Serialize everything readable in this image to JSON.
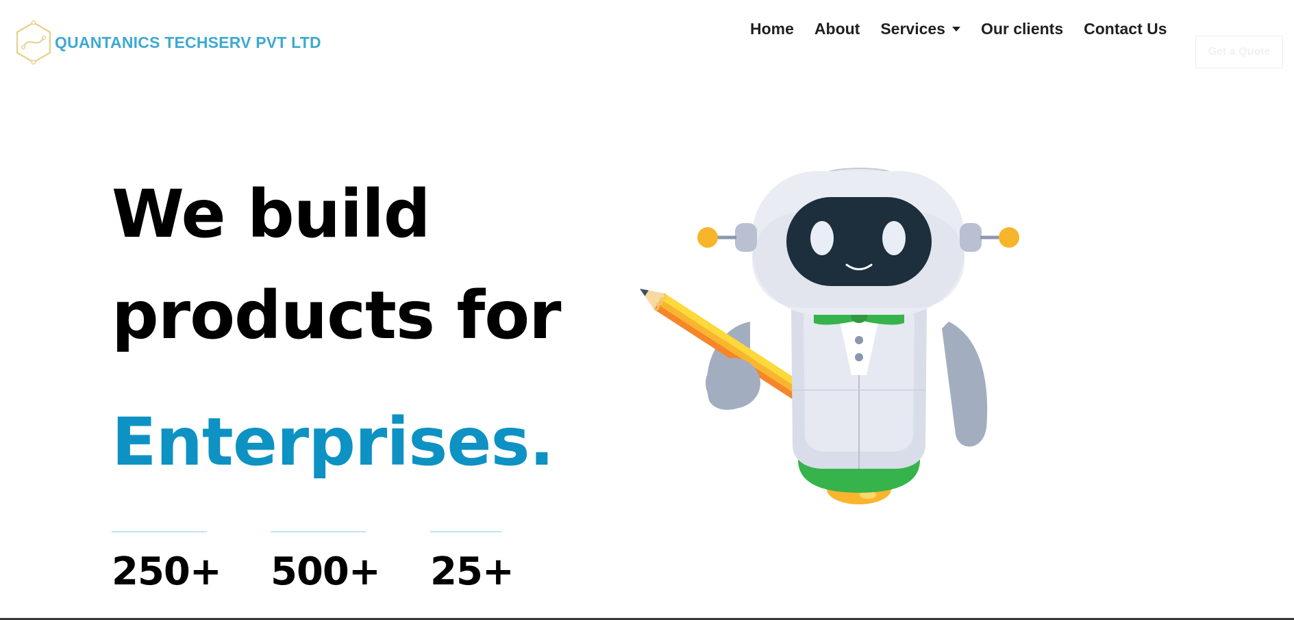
{
  "header": {
    "brand_name": "QUANTANICS TECHSERV PVT LTD",
    "logo_icon": "hexagon-logo-icon",
    "nav": [
      {
        "label": "Home"
      },
      {
        "label": "About"
      },
      {
        "label": "Services",
        "has_dropdown": true
      },
      {
        "label": "Our clients"
      },
      {
        "label": "Contact Us"
      }
    ],
    "quote_button": "Get a Quote"
  },
  "hero": {
    "line1": "We build",
    "line2": "products for",
    "line3": "Enterprises.",
    "illustration": "robot-with-pencil-illustration"
  },
  "stats": [
    {
      "value": "250+"
    },
    {
      "value": "500+"
    },
    {
      "value": "25+"
    }
  ],
  "colors": {
    "brand": "#3da9d1",
    "accent": "#0d92c3",
    "text": "#000000",
    "nav_text": "#1f1f1f"
  }
}
